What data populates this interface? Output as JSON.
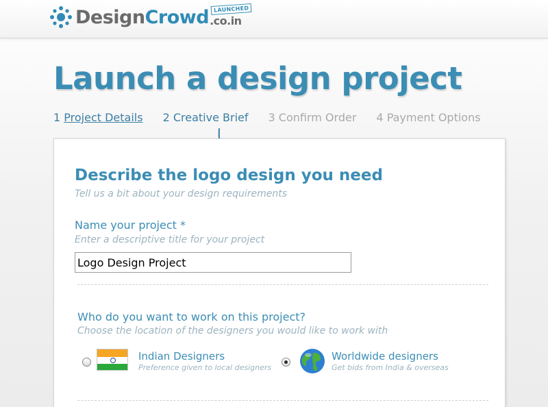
{
  "header": {
    "logo_design": "Design",
    "logo_crowd": "Crowd",
    "logo_tld": ".co.in",
    "badge": "LAUNCHED",
    "accent_color": "#2f8bb5"
  },
  "page": {
    "title": "Launch a design project"
  },
  "steps": [
    {
      "number": "1",
      "label": "Project Details",
      "state": "done"
    },
    {
      "number": "2",
      "label": "Creative Brief",
      "state": "current"
    },
    {
      "number": "3",
      "label": "Confirm Order",
      "state": "upcoming"
    },
    {
      "number": "4",
      "label": "Payment Options",
      "state": "upcoming"
    }
  ],
  "form": {
    "title": "Describe the logo design you need",
    "subtitle": "Tell us a bit about your design requirements",
    "project_name": {
      "label": "Name your project *",
      "hint": "Enter a descriptive title for your project",
      "value": "Logo Design Project"
    },
    "designers": {
      "question": "Who do you want to work on this project?",
      "hint": "Choose the location of the designers you would like to work with",
      "options": [
        {
          "title": "Indian Designers",
          "subtitle": "Preference given to local designers",
          "icon": "india-flag-icon",
          "selected": false
        },
        {
          "title": "Worldwide designers",
          "subtitle": "Get bids from India & overseas",
          "icon": "globe-icon",
          "selected": true
        }
      ]
    }
  }
}
